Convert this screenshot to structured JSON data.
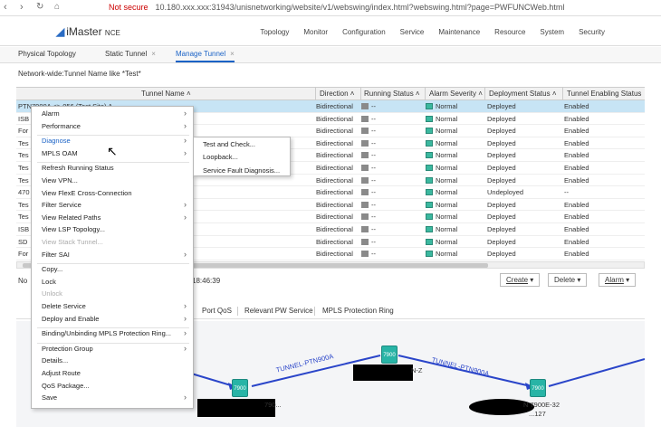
{
  "browser": {
    "security": "Not secure",
    "url": "10.180.xxx.xxx:31943/unisnetworking/website/v1/webswing/index.html?webswing.html?page=PWFUNCWeb.html"
  },
  "app": {
    "logo": "iMaster",
    "logo_suffix": "NCE"
  },
  "topnav": [
    "Topology",
    "Monitor",
    "Configuration",
    "Service",
    "Maintenance",
    "Resource",
    "System",
    "Security"
  ],
  "tabs": [
    {
      "label": "Physical Topology",
      "closable": false
    },
    {
      "label": "Static Tunnel",
      "closable": true
    },
    {
      "label": "Manage Tunnel",
      "closable": true,
      "active": true
    }
  ],
  "filter": "Network-wide:Tunnel Name like *Test*",
  "table": {
    "columns": [
      "Tunnel Name",
      "Direction",
      "Running Status",
      "Alarm Severity",
      "Deployment Status",
      "Tunnel Enabling Status"
    ],
    "rows": [
      {
        "name": "PTN7900A <> 056 (Test Site) A",
        "direction": "Bidirectional",
        "running": "--",
        "alarm": "Normal",
        "deploy": "Deployed",
        "enabling": "Enabled",
        "selected": true
      },
      {
        "name": "ISB",
        "direction": "Bidirectional",
        "running": "--",
        "alarm": "Normal",
        "deploy": "Deployed",
        "enabling": "Enabled"
      },
      {
        "name": "For",
        "direction": "Bidirectional",
        "running": "--",
        "alarm": "Normal",
        "deploy": "Deployed",
        "enabling": "Enabled"
      },
      {
        "name": "Tes",
        "direction": "Bidirectional",
        "running": "--",
        "alarm": "Normal",
        "deploy": "Deployed",
        "enabling": "Enabled"
      },
      {
        "name": "Tes",
        "direction": "Bidirectional",
        "running": "--",
        "alarm": "Normal",
        "deploy": "Deployed",
        "enabling": "Enabled"
      },
      {
        "name": "Tes",
        "direction": "Bidirectional",
        "running": "--",
        "alarm": "Normal",
        "deploy": "Deployed",
        "enabling": "Enabled"
      },
      {
        "name": "Tes",
        "direction": "Bidirectional",
        "running": "--",
        "alarm": "Normal",
        "deploy": "Deployed",
        "enabling": "Enabled"
      },
      {
        "name": "470",
        "direction": "Bidirectional",
        "running": "--",
        "alarm": "Normal",
        "deploy": "Undeployed",
        "enabling": "--"
      },
      {
        "name": "Tes",
        "direction": "Bidirectional",
        "running": "--",
        "alarm": "Normal",
        "deploy": "Deployed",
        "enabling": "Enabled"
      },
      {
        "name": "Tes",
        "direction": "Bidirectional",
        "running": "--",
        "alarm": "Normal",
        "deploy": "Deployed",
        "enabling": "Enabled"
      },
      {
        "name": "ISB",
        "direction": "Bidirectional",
        "running": "--",
        "alarm": "Normal",
        "deploy": "Deployed",
        "enabling": "Enabled"
      },
      {
        "name": "SD",
        "direction": "Bidirectional",
        "running": "--",
        "alarm": "Normal",
        "deploy": "Deployed",
        "enabling": "Enabled"
      },
      {
        "name": "For",
        "direction": "Bidirectional",
        "running": "--",
        "alarm": "Normal",
        "deploy": "Deployed",
        "enabling": "Enabled"
      }
    ]
  },
  "status": {
    "prefix": "No",
    "time": "18:46:39"
  },
  "actions": {
    "create": "Create",
    "delete": "Delete",
    "alarm": "Alarm"
  },
  "lower_tabs": [
    "Port QoS",
    "Relevant PW Service",
    "MPLS Protection Ring"
  ],
  "context_menu": [
    {
      "label": "Alarm",
      "sub": true
    },
    {
      "label": "Performance",
      "sub": true
    },
    {
      "sep": true
    },
    {
      "label": "Diagnose",
      "sub": true,
      "hl": true
    },
    {
      "label": "MPLS OAM",
      "sub": true
    },
    {
      "sep": true
    },
    {
      "label": "Refresh Running Status"
    },
    {
      "label": "View VPN..."
    },
    {
      "label": "View FlexE Cross-Connection"
    },
    {
      "label": "Filter Service",
      "sub": true
    },
    {
      "label": "View Related Paths",
      "sub": true
    },
    {
      "label": "View LSP Topology..."
    },
    {
      "label": "View Stack Tunnel...",
      "dis": true
    },
    {
      "label": "Filter SAI",
      "sub": true
    },
    {
      "sep": true
    },
    {
      "label": "Copy..."
    },
    {
      "label": "Lock"
    },
    {
      "label": "Unlock",
      "dis": true
    },
    {
      "label": "Delete Service",
      "sub": true
    },
    {
      "label": "Deploy and Enable",
      "sub": true
    },
    {
      "sep": true
    },
    {
      "label": "Binding/Unbinding MPLS Protection Ring...",
      "sub": true
    },
    {
      "sep": true
    },
    {
      "label": "Protection Group",
      "sub": true
    },
    {
      "label": "Details..."
    },
    {
      "label": "Adjust Route"
    },
    {
      "label": "QoS Package..."
    },
    {
      "label": "Save",
      "sub": true
    }
  ],
  "submenu": [
    "Test and Check...",
    "Loopback...",
    "Service Fault Diagnosis..."
  ],
  "topology": {
    "link_labels": [
      "TUNNEL-PTN900A",
      "TUNNEL-PTN900A"
    ],
    "node_labels": [
      "790...",
      "N-Z",
      "N 7900E-32",
      "...127"
    ],
    "node_badges": [
      "7900",
      "7900",
      "7900"
    ]
  }
}
